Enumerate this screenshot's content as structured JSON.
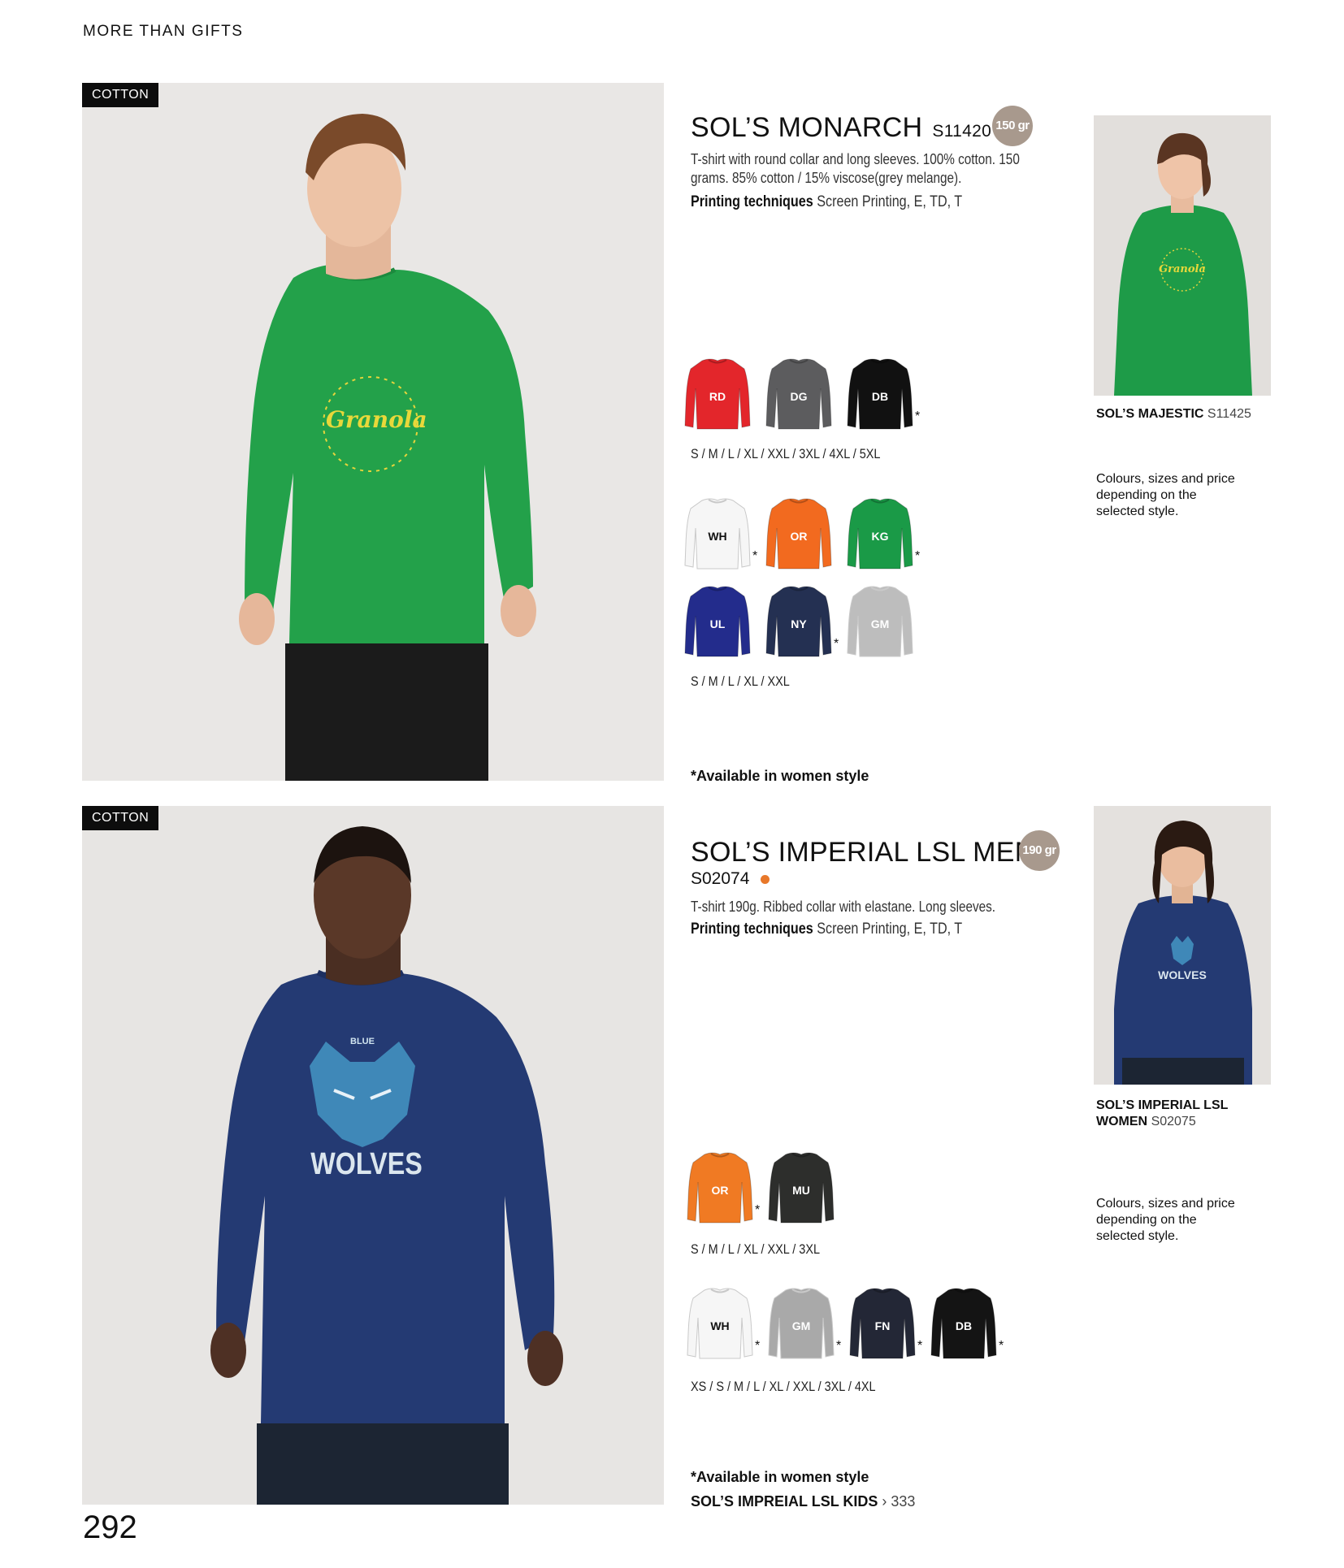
{
  "header": {
    "title": "MORE THAN GIFTS"
  },
  "page_number": "292",
  "products": [
    {
      "tag": "COTTON",
      "name": "SOL’S MONARCH",
      "code": "S11420",
      "weight": "150 gr",
      "description": "T-shirt with round collar and long sleeves. 100% cotton. 150 grams. 85% cotton / 15% viscose(grey melange).",
      "printing_label": "Printing techniques",
      "printing_value": "Screen Printing, E, TD, T",
      "print_graphic_text": "Granola",
      "colour_groups": [
        {
          "colours": [
            {
              "code": "RD",
              "hex": "#e3262b",
              "star": false
            },
            {
              "code": "DG",
              "hex": "#5c5c5e",
              "star": false
            },
            {
              "code": "DB",
              "hex": "#111111",
              "star": true
            }
          ],
          "sizes": "S / M / L / XL / XXL / 3XL / 4XL / 5XL"
        },
        {
          "colours": [
            {
              "code": "WH",
              "hex": "#f6f6f6",
              "star": true
            },
            {
              "code": "OR",
              "hex": "#f26a1f",
              "star": false
            },
            {
              "code": "KG",
              "hex": "#1a9a47",
              "star": true
            },
            {
              "code": "UL",
              "hex": "#232c8c",
              "star": false
            },
            {
              "code": "NY",
              "hex": "#243052",
              "star": true
            },
            {
              "code": "GM",
              "hex": "#bdbdbd",
              "star": false
            }
          ],
          "sizes": "S / M / L / XL / XXL"
        }
      ],
      "women_note": "*Available in women style",
      "side": {
        "name": "SOL’S MAJESTIC",
        "code": "S11425",
        "note": "Colours, sizes and price depending on the selected style."
      }
    },
    {
      "tag": "COTTON",
      "name": "SOL’S IMPERIAL LSL MEN",
      "code": "S02074",
      "weight": "190 gr",
      "description": "T-shirt 190g.  Ribbed collar with elastane. Long sleeves.",
      "printing_label": "Printing techniques",
      "printing_value": "Screen Printing, E, TD, T",
      "print_graphic_text": "WOLVES",
      "print_graphic_small": "BLUE",
      "colour_groups": [
        {
          "colours": [
            {
              "code": "OR",
              "hex": "#f07a23",
              "star": true
            },
            {
              "code": "MU",
              "hex": "#2d2e2c",
              "star": false
            }
          ],
          "sizes": "S / M / L / XL / XXL / 3XL"
        },
        {
          "colours": [
            {
              "code": "WH",
              "hex": "#f6f6f6",
              "star": true
            },
            {
              "code": "GM",
              "hex": "#a9a9a9",
              "star": true
            },
            {
              "code": "FN",
              "hex": "#232736",
              "star": true
            },
            {
              "code": "DB",
              "hex": "#141414",
              "star": true
            }
          ],
          "sizes": "XS / S / M / L / XL / XXL / 3XL / 4XL"
        }
      ],
      "women_note": "*Available in women style",
      "kids_link_label": "SOL’S IMPREIAL LSL KIDS",
      "kids_link_page": "› 333",
      "side": {
        "name_line1": "SOL’S IMPERIAL LSL",
        "name_line2": "WOMEN",
        "code": "S02075",
        "note": "Colours, sizes and price depending on the selected style."
      }
    }
  ]
}
